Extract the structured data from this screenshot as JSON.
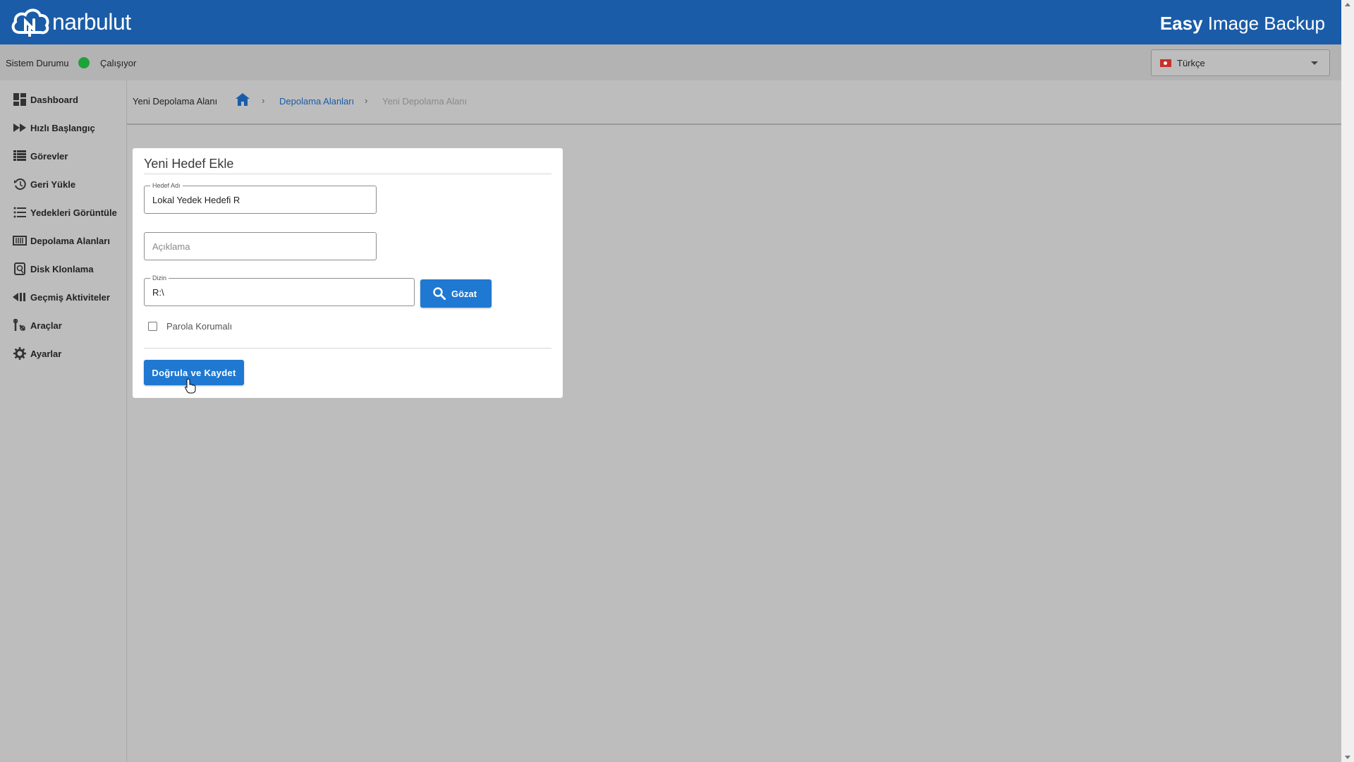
{
  "header": {
    "logo_text": "narbulut",
    "product_bold": "Easy",
    "product_rest": " Image Backup"
  },
  "status": {
    "label": "Sistem Durumu",
    "value": "Çalışıyor",
    "color": "#1fa23a"
  },
  "language": {
    "selected": "Türkçe",
    "flag_icon": "turkey-flag-icon"
  },
  "sidebar": {
    "items": [
      {
        "label": "Dashboard",
        "icon": "dashboard-icon"
      },
      {
        "label": "Hızlı Başlangıç",
        "icon": "fast-forward-icon"
      },
      {
        "label": "Görevler",
        "icon": "list-icon"
      },
      {
        "label": "Geri Yükle",
        "icon": "restore-icon"
      },
      {
        "label": "Yedekleri Görüntüle",
        "icon": "view-list-icon"
      },
      {
        "label": "Depolama Alanları",
        "icon": "storage-icon"
      },
      {
        "label": "Disk Klonlama",
        "icon": "disk-clone-icon"
      },
      {
        "label": "Geçmiş Aktiviteler",
        "icon": "history-icon"
      },
      {
        "label": "Araçlar",
        "icon": "tools-icon"
      },
      {
        "label": "Ayarlar",
        "icon": "gear-icon"
      }
    ]
  },
  "breadcrumb": {
    "title": "Yeni Depolama Alanı",
    "link": "Depolama Alanları",
    "current": "Yeni Depolama Alanı",
    "separator": "›"
  },
  "form": {
    "title": "Yeni Hedef Ekle",
    "name_legend": "Hedef Adı",
    "name_value": "Lokal Yedek Hedefi R",
    "description_placeholder": "Açıklama",
    "dir_legend": "Dizin",
    "dir_value": "R:\\",
    "browse_label": "Gözat",
    "password_label": "Parola Korumalı",
    "save_label": "Doğrula ve Kaydet"
  },
  "colors": {
    "header_bg": "#1a5ca8",
    "primary_button": "#1f78d1",
    "status_ok": "#1fa23a"
  }
}
